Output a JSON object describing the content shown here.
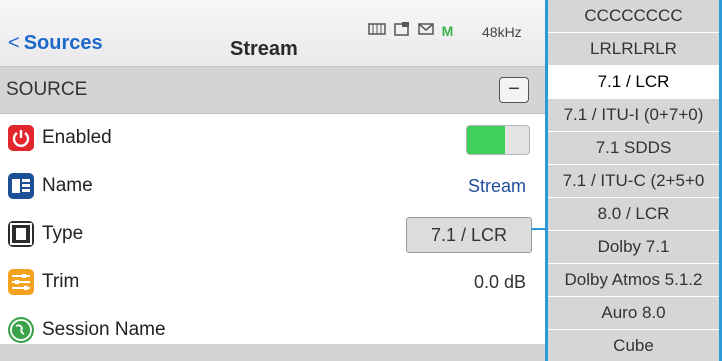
{
  "navbar": {
    "back_label": "Sources",
    "title": "Stream",
    "status_m": "M",
    "sample_rate": "48kHz"
  },
  "section": {
    "label": "SOURCE",
    "collapse_symbol": "−"
  },
  "rows": [
    {
      "label": "Enabled",
      "icon": "power-icon",
      "toggle_on": true
    },
    {
      "label": "Name",
      "icon": "name-tag-icon",
      "value": "Stream"
    },
    {
      "label": "Type",
      "icon": "speaker-icon",
      "value": "7.1 / LCR"
    },
    {
      "label": "Trim",
      "icon": "sliders-icon",
      "value": "0.0 dB"
    },
    {
      "label": "Session Name",
      "icon": "globe-icon",
      "value": ""
    }
  ],
  "dropdown": {
    "options": [
      "CCCCCCCC",
      "LRLRLRLR",
      "7.1 / LCR",
      "7.1 / ITU-I (0+7+0)",
      "7.1 SDDS",
      "7.1 / ITU-C (2+5+0",
      "8.0 / LCR",
      "Dolby 7.1",
      "Dolby Atmos 5.1.2",
      "Auro 8.0",
      "Cube"
    ],
    "selected": "7.1 / LCR"
  },
  "colors": {
    "accent_blue": "#1d68c9",
    "toggle_green": "#3fcf5a",
    "dropdown_border": "#2c9ad6"
  }
}
